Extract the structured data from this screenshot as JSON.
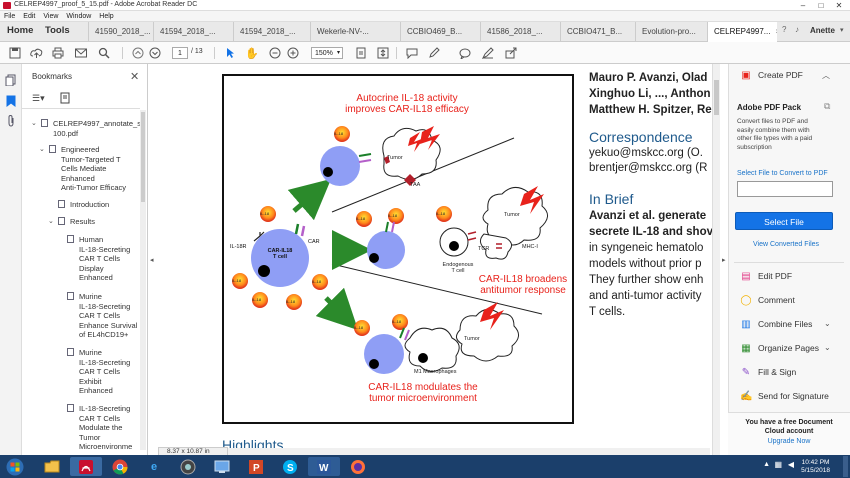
{
  "window": {
    "title": "CELREP4997_proof_5_15.pdf - Adobe Acrobat Reader DC",
    "controls": [
      "–",
      "□",
      "✕"
    ]
  },
  "menu": [
    "File",
    "Edit",
    "View",
    "Window",
    "Help"
  ],
  "nav": {
    "home": "Home",
    "tools": "Tools"
  },
  "tabs": [
    {
      "label": "41590_2018_...",
      "active": false
    },
    {
      "label": "41594_2018_...",
      "active": false
    },
    {
      "label": "41594_2018_...",
      "active": false
    },
    {
      "label": "Wekerle-NV-...",
      "active": false
    },
    {
      "label": "CCBIO469_B...",
      "active": false
    },
    {
      "label": "41586_2018_...",
      "active": false
    },
    {
      "label": "CCBIO471_B...",
      "active": false
    },
    {
      "label": "Evolution-pro...",
      "active": false
    },
    {
      "label": "CELREP4997...",
      "active": true
    }
  ],
  "user": {
    "name": "Anette"
  },
  "toolbar": {
    "page_current": "1",
    "page_total": "/ 13",
    "zoom": "150%"
  },
  "bookmarks": {
    "header": "Bookmarks",
    "items": [
      {
        "label": "CELREP4997_annotate_s\n100.pdf",
        "level": 0,
        "expanded": true
      },
      {
        "label": "Engineered\nTumor-Targeted T\nCells Mediate\nEnhanced\nAnti-Tumor Efficacy",
        "level": 1,
        "expanded": true
      },
      {
        "label": "Introduction",
        "level": 2
      },
      {
        "label": "Results",
        "level": 1,
        "expanded": true
      },
      {
        "label": "Human\nIL-18-Secreting\nCAR T Cells\nDisplay\nEnhanced",
        "level": 2
      },
      {
        "label": "Murine\nIL-18-Secreting\nCAR T Cells\nEnhance Survival\nof EL4hCD19+",
        "level": 2
      },
      {
        "label": "Murine\nIL-18-Secreting\nCAR T Cells\nExhibit\nEnhanced",
        "level": 2
      },
      {
        "label": "IL-18-Secreting\nCAR T Cells\nModulate the\nTumor\nMicroenvironme",
        "level": 2
      }
    ]
  },
  "figure": {
    "autocrine_title": "Autocrine IL-18 activity\nimproves CAR-IL18 efficacy",
    "broadens_title": "CAR-IL18 broadens\nantitumor response",
    "modulates_title": "CAR-IL18 modulates the\ntumor microenvironment",
    "il18": "IL-18",
    "il18r": "IL-18R",
    "car": "CAR",
    "car_cell": "CAR-IL18\nT cell",
    "tumor": "Tumor",
    "taa": "TAA",
    "tcr": "TCR",
    "mhc": "MHC-I",
    "endogenous": "Endogenous\nT cell",
    "m1": "M1 Macrophages"
  },
  "article": {
    "authors": [
      "Mauro P. Avanzi, Olad",
      "Xinghuo Li, ..., Anthon",
      "Matthew H. Spitzer, Re"
    ],
    "correspondence_heading": "Correspondence",
    "emails": [
      "yekuo@mskcc.org (O.",
      "brentjer@mskcc.org (R"
    ],
    "brief_heading": "In Brief",
    "brief_lines": [
      "Avanzi et al. generate",
      "secrete IL-18 and shov",
      "in syngeneic hematolo",
      "models without prior p",
      "They further show enh",
      "and anti-tumor activity",
      "T cells."
    ],
    "highlights_heading": "Highlights"
  },
  "status": {
    "page_size": "8.37 x 10.87 in"
  },
  "right_panel": {
    "create_pdf": "Create PDF",
    "pack_title": "Adobe PDF Pack",
    "pack_desc": "Convert files to PDF and easily combine them with other file types with a paid subscription",
    "select_label": "Select File to Convert to PDF",
    "select_button": "Select File",
    "view_converted": "View Converted Files",
    "tools": [
      {
        "label": "Edit PDF",
        "icon": "edit-pdf-icon",
        "chevron": false
      },
      {
        "label": "Comment",
        "icon": "comment-icon",
        "chevron": false
      },
      {
        "label": "Combine Files",
        "icon": "combine-icon",
        "chevron": true
      },
      {
        "label": "Organize Pages",
        "icon": "organize-icon",
        "chevron": true
      },
      {
        "label": "Fill & Sign",
        "icon": "fill-sign-icon",
        "chevron": false
      },
      {
        "label": "Send for Signature",
        "icon": "send-signature-icon",
        "chevron": false
      }
    ],
    "promo_text": "You have a free Document\nCloud account",
    "upgrade": "Upgrade Now"
  },
  "taskbar": {
    "time": "10:42 PM",
    "date": "5/15/2018"
  },
  "colors": {
    "accent": "#1473e6",
    "figure_red": "#e8221b",
    "cell_blue": "#8f9ef5",
    "arrow_green": "#2b8a2b",
    "taskbar": "#1b3f6b"
  }
}
